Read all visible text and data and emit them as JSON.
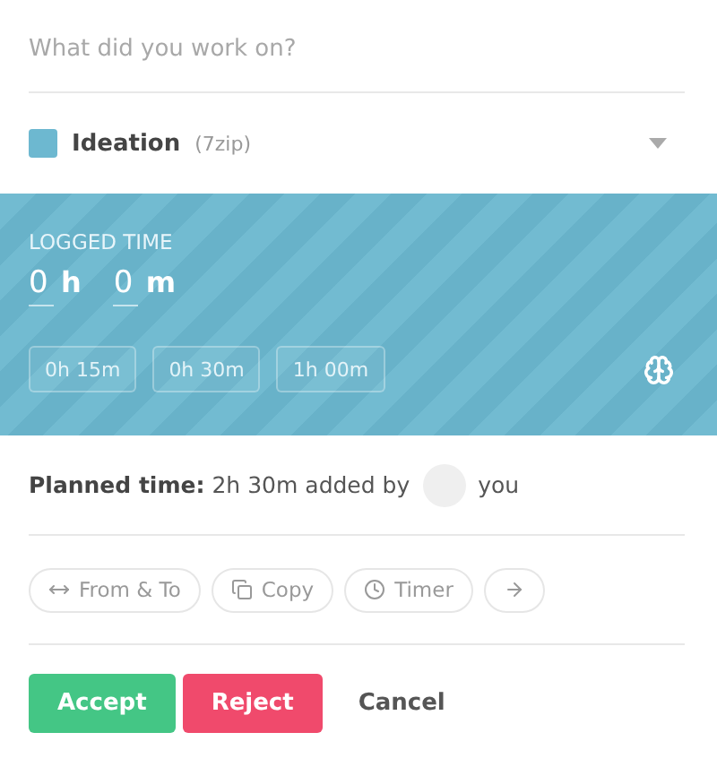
{
  "entry": {
    "placeholder": "What did you work on?"
  },
  "project": {
    "name": "Ideation",
    "client": "(7zip)",
    "color": "#6db8d0"
  },
  "logged_time": {
    "label": "LOGGED TIME",
    "hours": "0",
    "hours_unit": "h",
    "minutes": "0",
    "minutes_unit": "m",
    "presets": [
      "0h 15m",
      "0h 30m",
      "1h 00m"
    ]
  },
  "planned": {
    "label": "Planned time:",
    "value": "2h 30m",
    "added_by": "added by",
    "user": "you"
  },
  "actions": [
    {
      "kind": "from-to",
      "label": "From & To"
    },
    {
      "kind": "copy",
      "label": "Copy"
    },
    {
      "kind": "timer",
      "label": "Timer"
    },
    {
      "kind": "next"
    }
  ],
  "buttons": [
    {
      "kind": "accept",
      "label": "Accept"
    },
    {
      "kind": "reject",
      "label": "Reject"
    },
    {
      "kind": "cancel",
      "label": "Cancel"
    }
  ]
}
